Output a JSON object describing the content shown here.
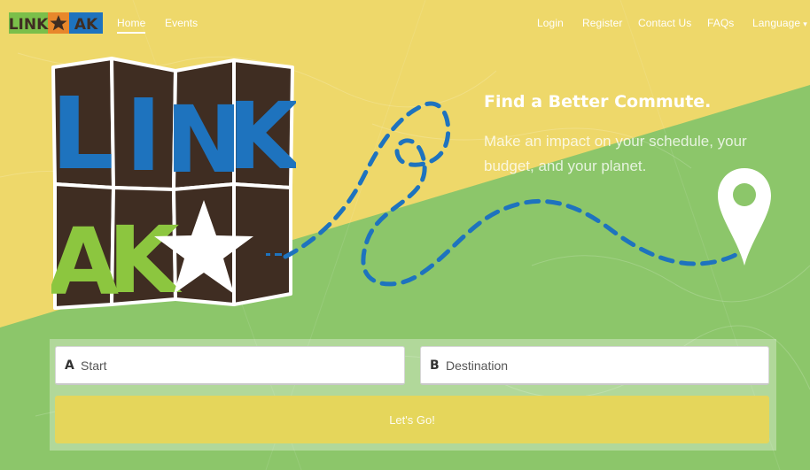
{
  "brand": {
    "logo_text_left": "LINK",
    "logo_text_right": "AK",
    "colors": {
      "green": "#7bbf4a",
      "blue": "#1e73be",
      "orange": "#e8872b"
    }
  },
  "nav": {
    "left": [
      {
        "label": "Home",
        "active": true
      },
      {
        "label": "Events",
        "active": false
      }
    ],
    "right": [
      {
        "label": "Login"
      },
      {
        "label": "Register"
      },
      {
        "label": "Contact Us"
      },
      {
        "label": "FAQs"
      },
      {
        "label": "Language",
        "icon": "caret-down-icon"
      }
    ]
  },
  "hero": {
    "logo_top": "LINK",
    "logo_bottom": "AK",
    "tagline": "Find a Better Commute.",
    "subtext": "Make an impact on your schedule, your budget, and your planet.",
    "icons": [
      "star-icon",
      "map-pin-icon",
      "dashed-route"
    ],
    "colors": {
      "yellow": "#eed86a",
      "green": "#8cc66a",
      "brown": "#3f2d22",
      "blue": "#1e73be",
      "lime": "#8cc63f"
    }
  },
  "search": {
    "start_letter": "A",
    "start_placeholder": "Start",
    "destination_letter": "B",
    "destination_placeholder": "Destination",
    "go_label": "Let's Go!",
    "button_color": "#e5d65b"
  }
}
